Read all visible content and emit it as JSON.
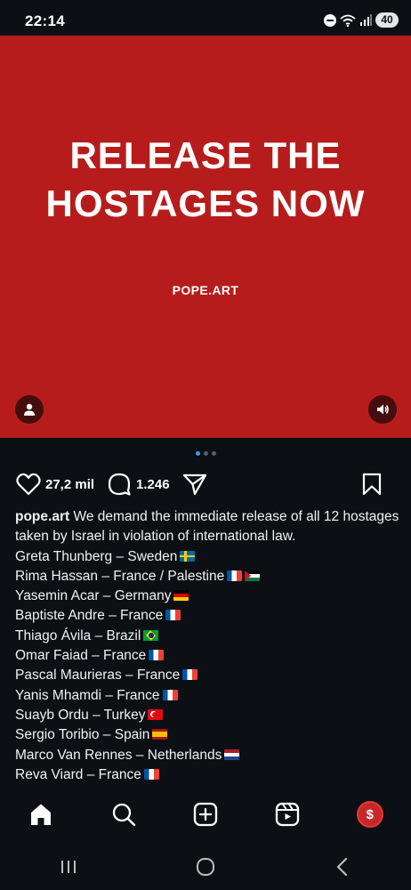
{
  "status_bar": {
    "time": "22:14",
    "battery": "40",
    "icons": [
      "do-not-disturb-icon",
      "wifi-icon",
      "signal-icon",
      "battery-icon"
    ]
  },
  "post": {
    "image": {
      "background_color": "#b71c1c",
      "headline_line1": "RELEASE THE",
      "headline_line2": "HOSTAGES NOW",
      "handle": "POPE.ART"
    },
    "carousel": {
      "count": 3,
      "active_index": 0
    },
    "actions": {
      "likes": "27,2 mil",
      "comments": "1.246"
    },
    "caption": {
      "username": "pope.art",
      "text": "We demand the immediate release of all 12 hostages taken by Israel in violation of international law.",
      "lines": [
        {
          "text": "Greta Thunberg – Sweden",
          "flags": [
            "se"
          ]
        },
        {
          "text": "Rima Hassan – France / Palestine",
          "flags": [
            "fr",
            "ps"
          ]
        },
        {
          "text": "Yasemin Acar – Germany",
          "flags": [
            "de"
          ]
        },
        {
          "text": "Baptiste Andre – France",
          "flags": [
            "fr"
          ]
        },
        {
          "text": "Thiago Ávila – Brazil",
          "flags": [
            "br"
          ]
        },
        {
          "text": "Omar Faiad – France",
          "flags": [
            "fr"
          ]
        },
        {
          "text": "Pascal Maurieras – France",
          "flags": [
            "fr"
          ]
        },
        {
          "text": "Yanis Mhamdi – France",
          "flags": [
            "fr"
          ]
        },
        {
          "text": "Suayb Ordu – Turkey",
          "flags": [
            "tr"
          ]
        },
        {
          "text": "Sergio Toribio – Spain",
          "flags": [
            "es"
          ]
        },
        {
          "text": "Marco Van Rennes – Netherlands",
          "flags": [
            "nl"
          ]
        },
        {
          "text": "Reva Viard – France",
          "flags": [
            "fr"
          ]
        }
      ]
    }
  },
  "bottom_nav": {
    "items": [
      "home-icon",
      "search-icon",
      "create-icon",
      "reels-icon",
      "profile-avatar"
    ]
  },
  "system_nav": {
    "items": [
      "recents-icon",
      "home-circle-icon",
      "back-icon"
    ]
  }
}
